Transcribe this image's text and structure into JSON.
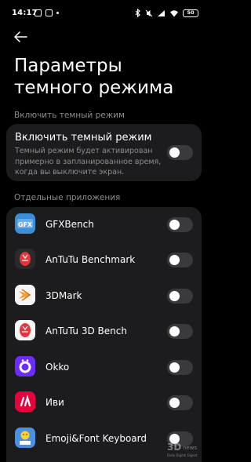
{
  "status_bar": {
    "time": "14:17",
    "battery": "50",
    "left_icons": [
      "notification-icon",
      "sim-icon",
      "more-dot-icon"
    ],
    "right_icons": [
      "bluetooth-icon",
      "silent-icon",
      "signal-icon",
      "wifi-icon",
      "battery-icon"
    ]
  },
  "header": {
    "back_icon": "back-arrow-icon",
    "title": "Параметры темного режима"
  },
  "dark_mode_section": {
    "label": "Включить темный режим",
    "title": "Включить темный режим",
    "description": "Темный режим будет активирован примерно в запланированное время, когда вы выключите экран.",
    "enabled": false
  },
  "apps_section": {
    "label": "Отдельные приложения",
    "items": [
      {
        "name": "GFXBench",
        "icon": "gfxbench-icon",
        "icon_color": "#3b8fd9",
        "enabled": false
      },
      {
        "name": "AnTuTu Benchmark",
        "icon": "antutu-icon",
        "icon_color": "#e8333a",
        "enabled": false
      },
      {
        "name": "3DMark",
        "icon": "3dmark-icon",
        "icon_color": "#f0a030",
        "enabled": false
      },
      {
        "name": "AnTuTu 3D Bench",
        "icon": "antutu-3d-icon",
        "icon_color": "#e8333a",
        "enabled": false
      },
      {
        "name": "Okko",
        "icon": "okko-icon",
        "icon_color": "#6d2bff",
        "enabled": false
      },
      {
        "name": "Иви",
        "icon": "ivi-icon",
        "icon_color": "#ea003d",
        "enabled": false
      },
      {
        "name": "Emoji&Font Keyboard",
        "icon": "emoji-keyboard-icon",
        "icon_color": "#4a90e2",
        "enabled": false
      }
    ]
  },
  "colors": {
    "background": "#000000",
    "card": "#1c1c1e",
    "secondary_text": "#8c8c8c",
    "toggle_off": "#3a3a3c"
  },
  "watermark": {
    "logo": "3dnews-watermark-logo",
    "text": "3Dnews Daily Digital Digest"
  }
}
